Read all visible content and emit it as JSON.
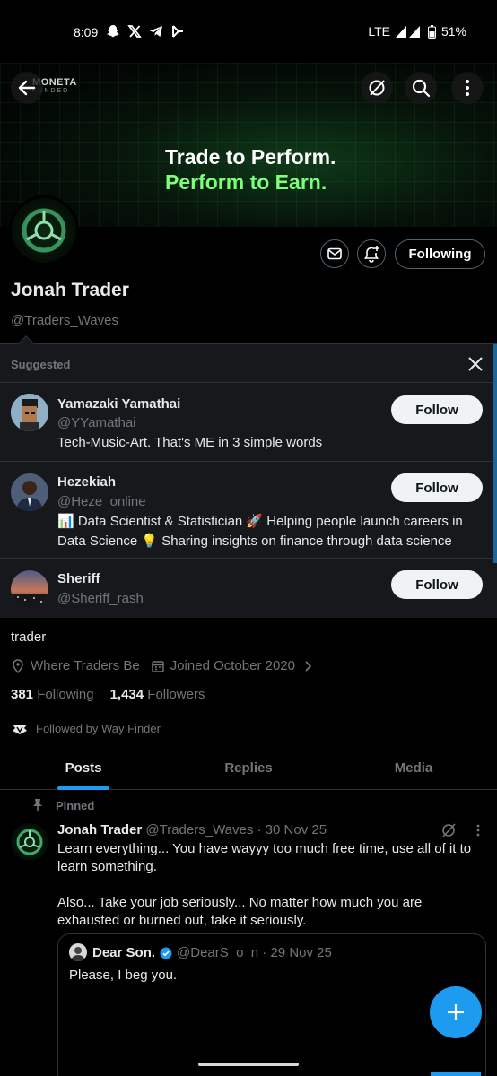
{
  "status_bar": {
    "time": "8:09",
    "network": "LTE",
    "battery": "51%"
  },
  "banner": {
    "logo_text": "MONETA",
    "logo_sub": "FUNDED",
    "headline_1": "Trade to Perform.",
    "headline_2": "Perform to Earn."
  },
  "profile": {
    "name": "Jonah Trader",
    "handle": "@Traders_Waves",
    "following_button": "Following",
    "bio": "trader",
    "location": "Where Traders Be",
    "joined": "Joined October 2020",
    "following_count": "381",
    "following_label": "Following",
    "followers_count": "1,434",
    "followers_label": "Followers",
    "followed_by": "Followed by Way Finder"
  },
  "suggested": {
    "header": "Suggested",
    "users": [
      {
        "name": "Yamazaki Yamathai",
        "handle": "@YYamathai",
        "bio": "Tech-Music-Art. That's ME in 3 simple words",
        "button": "Follow"
      },
      {
        "name": "Hezekiah",
        "handle": "@Heze_online",
        "bio": "📊 Data Scientist & Statistician 🚀 Helping people launch careers in Data Science 💡 Sharing insights on finance through data science",
        "button": "Follow"
      },
      {
        "name": "Sheriff",
        "handle": "@Sheriff_rash",
        "bio": "",
        "button": "Follow"
      }
    ]
  },
  "tabs": [
    {
      "label": "Posts"
    },
    {
      "label": "Replies"
    },
    {
      "label": "Media"
    }
  ],
  "post": {
    "pinned_label": "Pinned",
    "author": "Jonah Trader",
    "meta": "@Traders_Waves · 30 Nov 25",
    "paragraph_1": "Learn everything... You have wayyy too much free time, use all of it to learn something.",
    "paragraph_2": "Also... Take your job seriously... No matter how much you are exhausted or burned out, take it seriously.",
    "quote": {
      "author": "Dear Son.",
      "meta": "@DearS_o_n · 29 Nov 25",
      "text": "Please, I beg you."
    }
  },
  "colors": {
    "accent": "#1d9bf0",
    "background": "#000000",
    "secondary_text": "#71767b",
    "banner_green": "#7dff7a"
  }
}
